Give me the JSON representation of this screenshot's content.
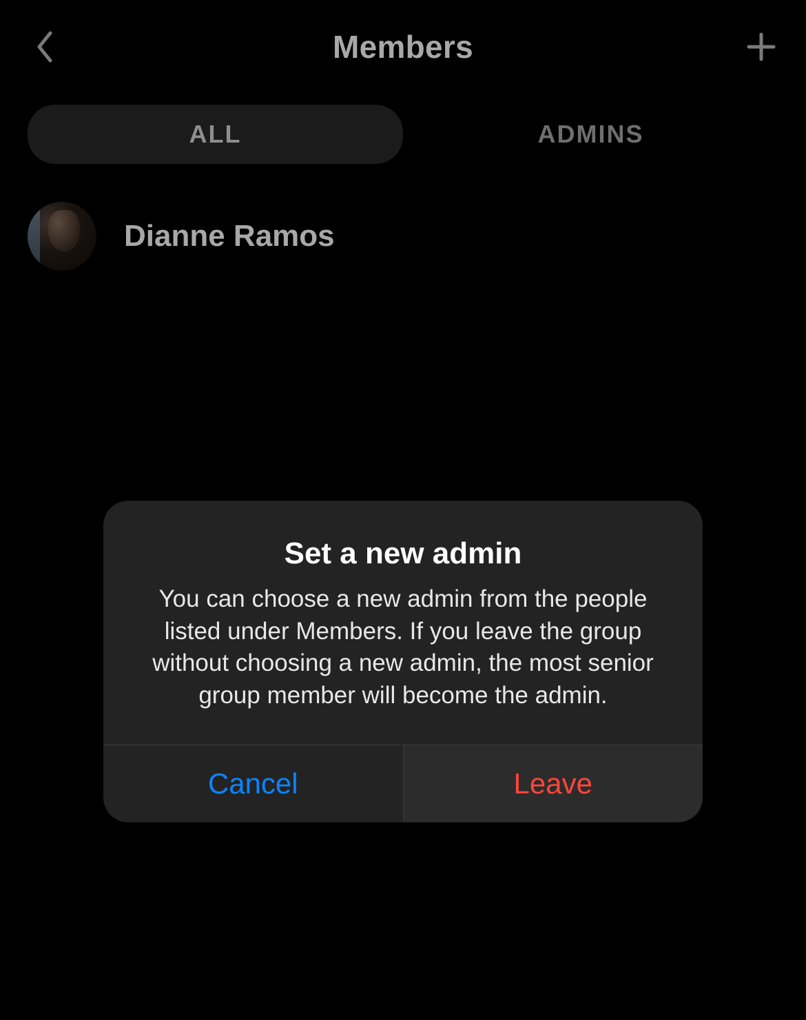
{
  "header": {
    "title": "Members"
  },
  "tabs": {
    "all": "ALL",
    "admins": "ADMINS"
  },
  "members": [
    {
      "name": "Dianne Ramos"
    }
  ],
  "dialog": {
    "title": "Set a new admin",
    "body": "You can choose a new admin from the people listed under Members. If you leave the group without choosing a new admin, the most senior group member will become the admin.",
    "cancel_label": "Cancel",
    "leave_label": "Leave"
  }
}
